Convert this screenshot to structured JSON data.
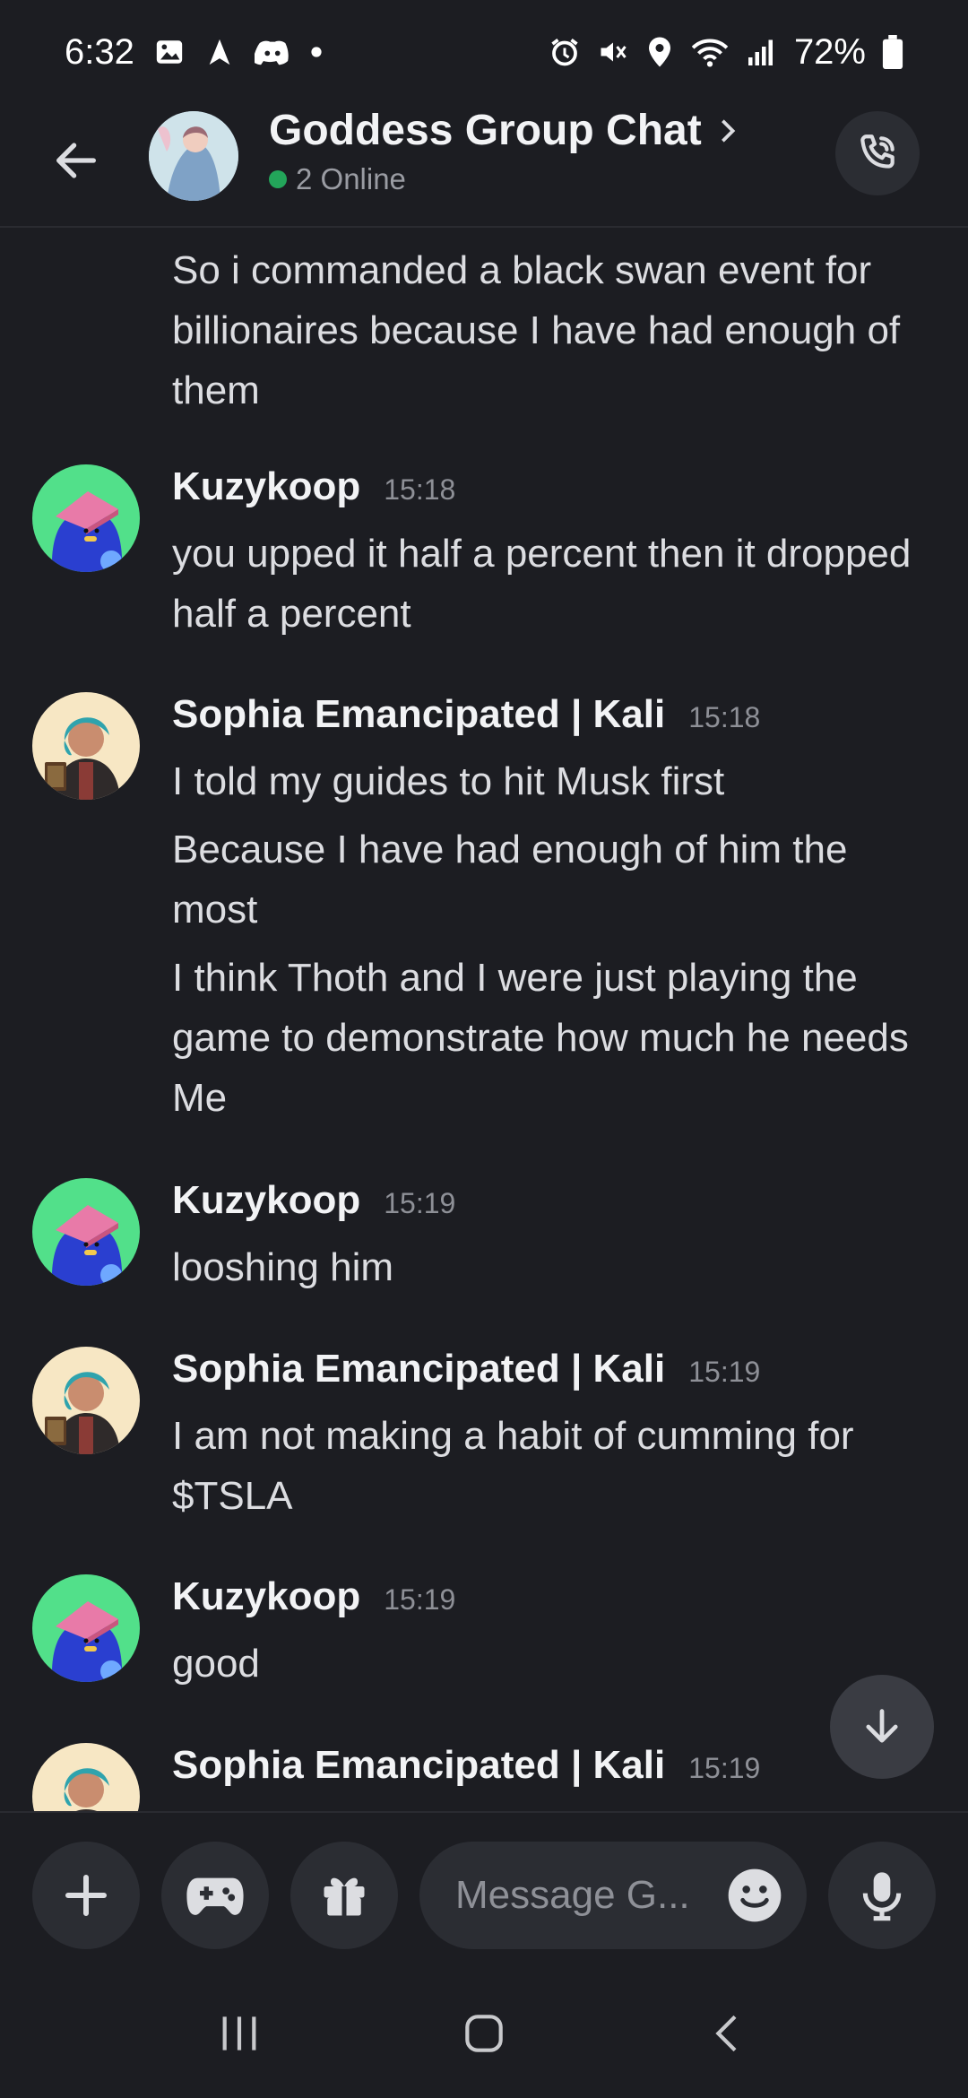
{
  "status_bar": {
    "time": "6:32",
    "battery": "72%"
  },
  "header": {
    "title": "Goddess Group Chat",
    "online": "2 Online"
  },
  "messages": [
    {
      "continuation": true,
      "lines": [
        "So i commanded a black swan event for billionaires because I have had enough of them"
      ]
    },
    {
      "username": "Kuzykoop",
      "timestamp": "15:18",
      "lines": [
        "you upped it half a percent then it dropped half a percent"
      ]
    },
    {
      "username": "Sophia Emancipated | Kali",
      "timestamp": "15:18",
      "lines": [
        "I told my guides to hit Musk first",
        "Because I have had enough of him the most",
        "I think Thoth and I were just playing the game to demonstrate how much he needs Me"
      ]
    },
    {
      "username": "Kuzykoop",
      "timestamp": "15:19",
      "lines": [
        "looshing him"
      ]
    },
    {
      "username": "Sophia Emancipated | Kali",
      "timestamp": "15:19",
      "lines": [
        "I am not making a habit of cumming for $TSLA"
      ]
    },
    {
      "username": "Kuzykoop",
      "timestamp": "15:19",
      "lines": [
        "good"
      ]
    },
    {
      "username": "Sophia Emancipated | Kali",
      "timestamp": "15:19",
      "lines": []
    }
  ],
  "composer": {
    "placeholder": "Message G..."
  },
  "colors": {
    "background": "#1c1d22",
    "online": "#23a55a",
    "surface": "#2b2d33"
  }
}
